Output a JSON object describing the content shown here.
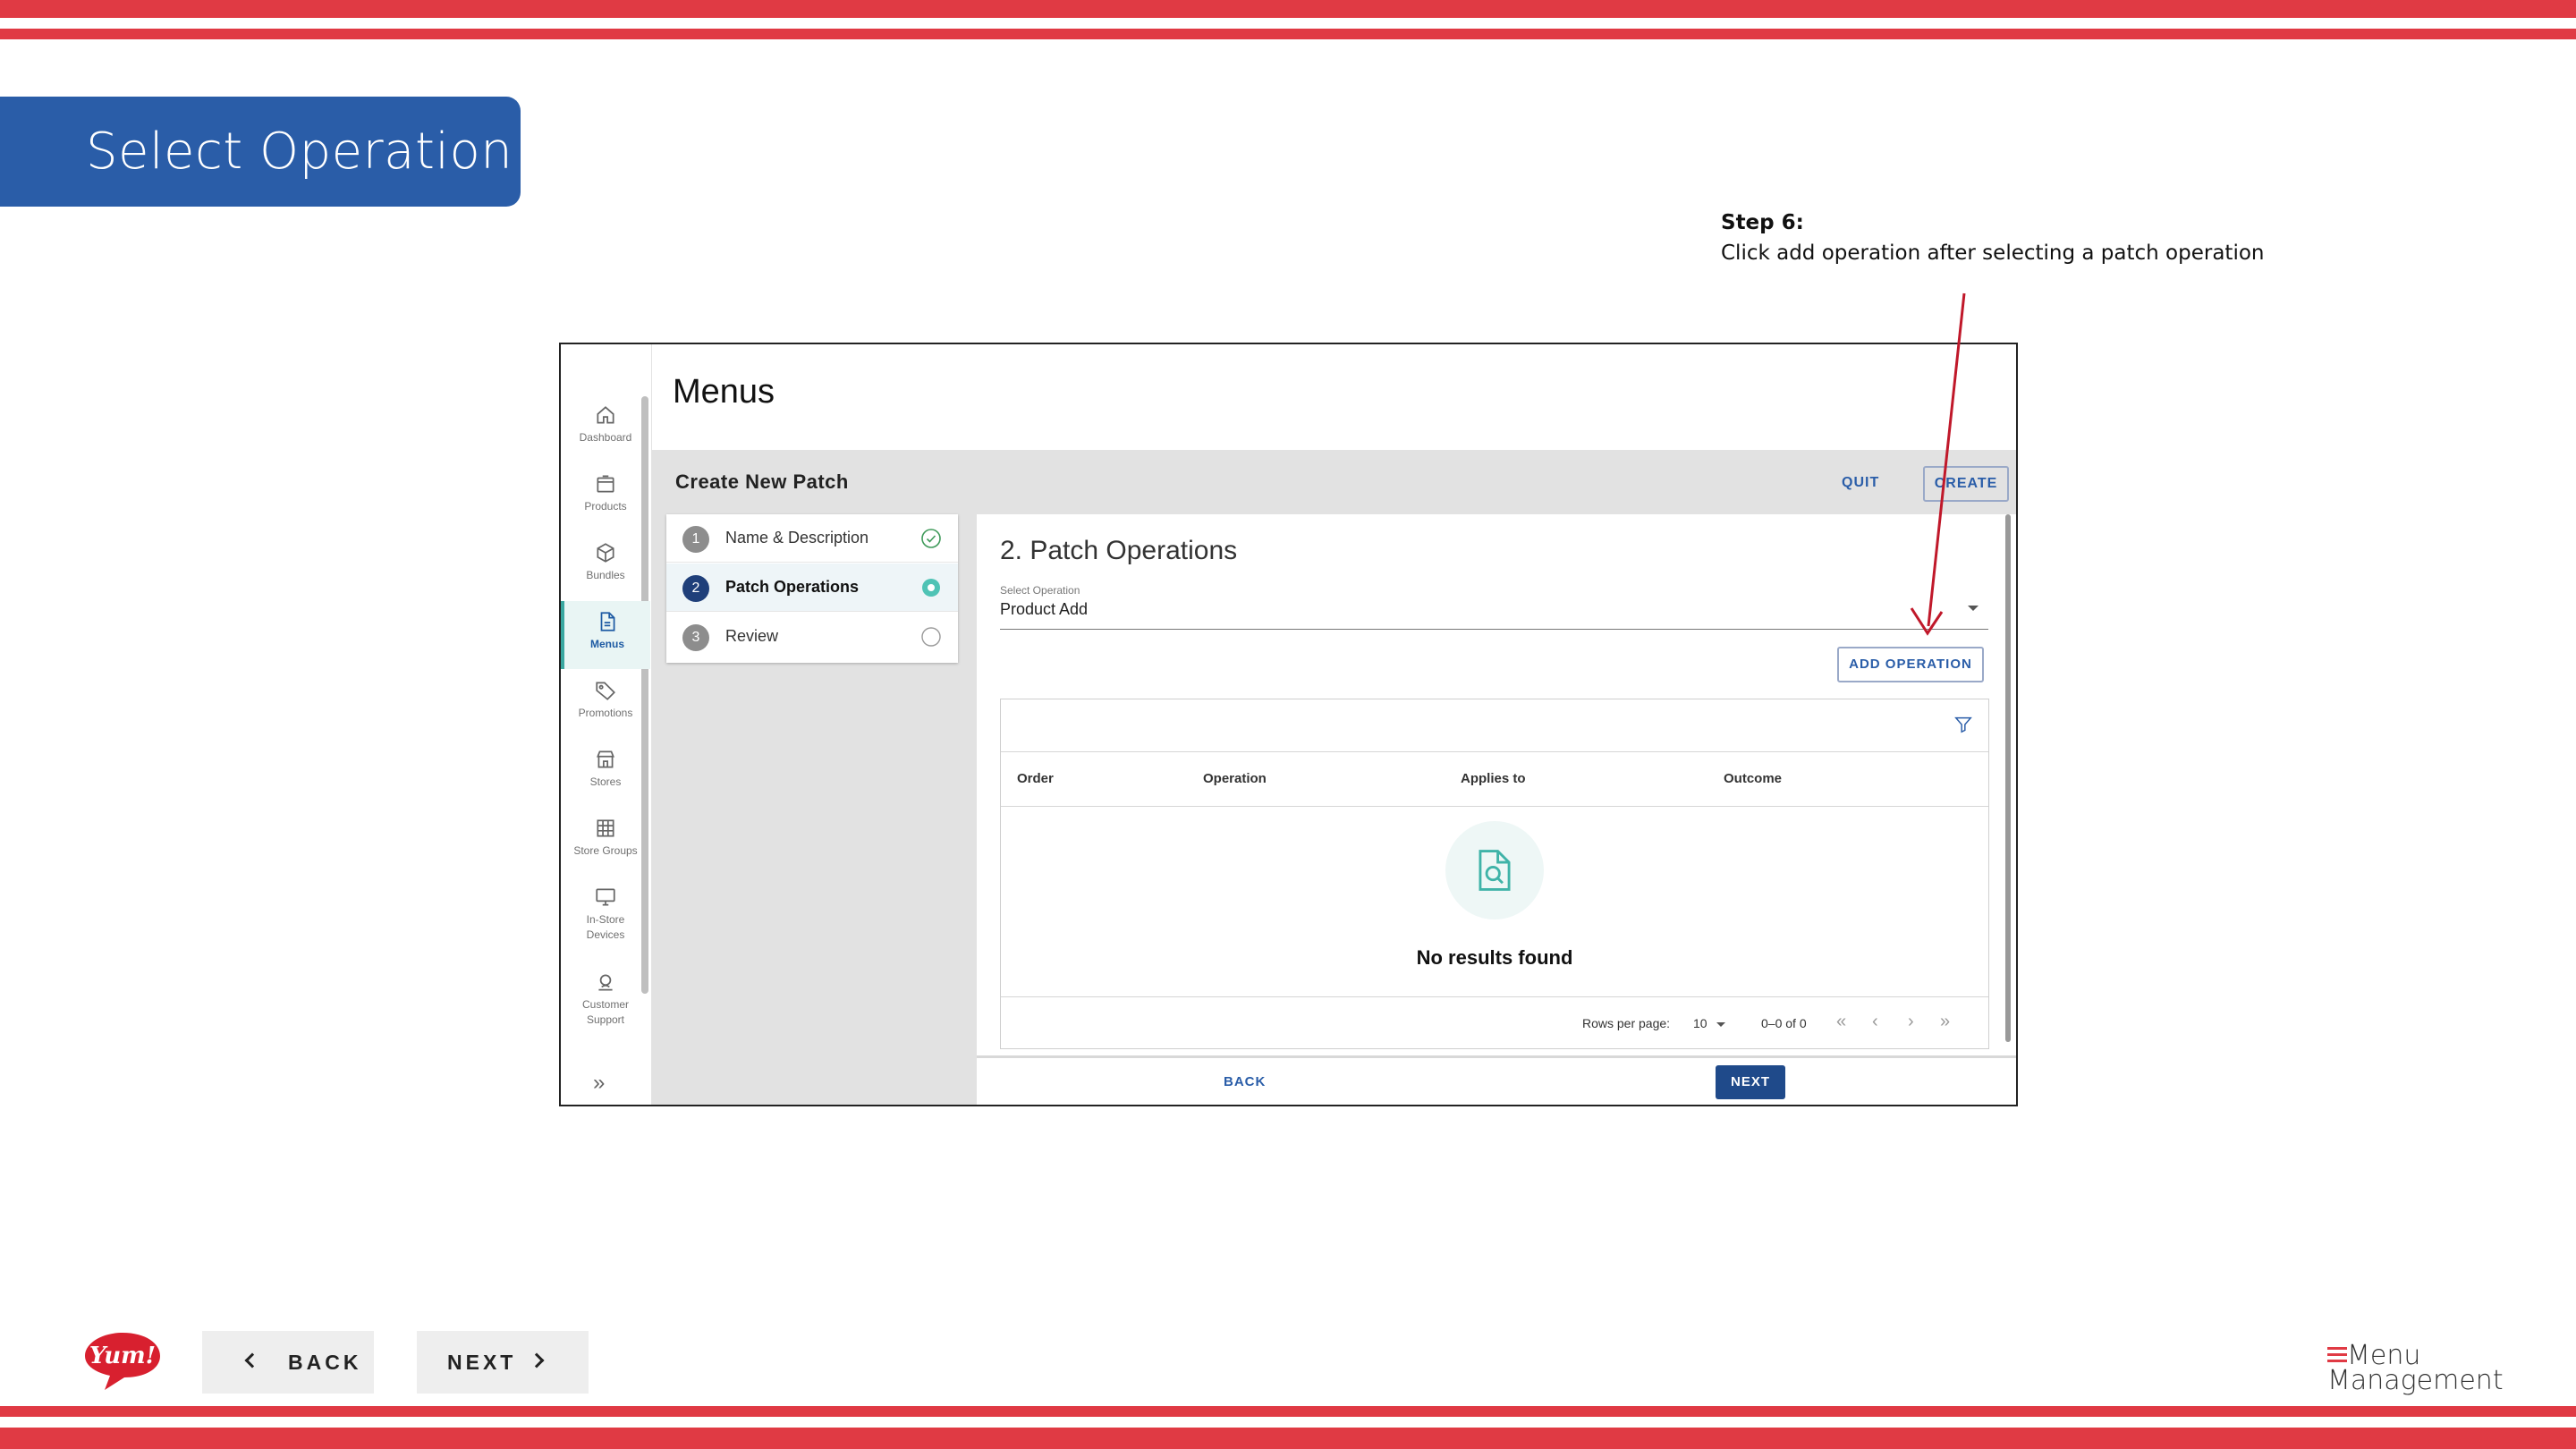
{
  "slide": {
    "title": "Select Operation",
    "step_label": "Step 6:",
    "step_text": "Click add operation after selecting a patch operation",
    "nav_back": "BACK",
    "nav_next": "NEXT",
    "logo_text": "Yum!",
    "brand_line1": "Menu",
    "brand_line2": "Management"
  },
  "colors": {
    "stripe": "#e03a44",
    "banner": "#2a5da8",
    "accent": "#3aa7a0",
    "primary": "#1f4a8a"
  },
  "sidebar": {
    "items": [
      {
        "label": "Dashboard",
        "icon": "home-icon"
      },
      {
        "label": "Products",
        "icon": "box-icon"
      },
      {
        "label": "Bundles",
        "icon": "cube-icon"
      },
      {
        "label": "Menus",
        "icon": "document-icon",
        "active": true
      },
      {
        "label": "Promotions",
        "icon": "tag-icon"
      },
      {
        "label": "Stores",
        "icon": "store-icon"
      },
      {
        "label": "Store Groups",
        "icon": "grid-icon"
      },
      {
        "label": "In-Store Devices",
        "icon": "monitor-icon"
      },
      {
        "label": "Customer Support",
        "icon": "support-icon"
      }
    ]
  },
  "app": {
    "page_title": "Menus",
    "toolbar_title": "Create New Patch",
    "quit": "QUIT",
    "create": "CREATE"
  },
  "stepper": [
    {
      "num": "1",
      "name": "Name & Description",
      "state": "complete"
    },
    {
      "num": "2",
      "name": "Patch Operations",
      "state": "current"
    },
    {
      "num": "3",
      "name": "Review",
      "state": "pending"
    }
  ],
  "patch": {
    "section_title": "2. Patch Operations",
    "select_label": "Select Operation",
    "select_value": "Product Add",
    "add_operation": "ADD OPERATION",
    "columns": [
      "Order",
      "Operation",
      "Applies to",
      "Outcome"
    ],
    "empty_text": "No results found",
    "rows_per_page_label": "Rows per page:",
    "rows_per_page_value": "10",
    "range": "0–0 of 0",
    "back": "BACK",
    "next": "NEXT"
  }
}
